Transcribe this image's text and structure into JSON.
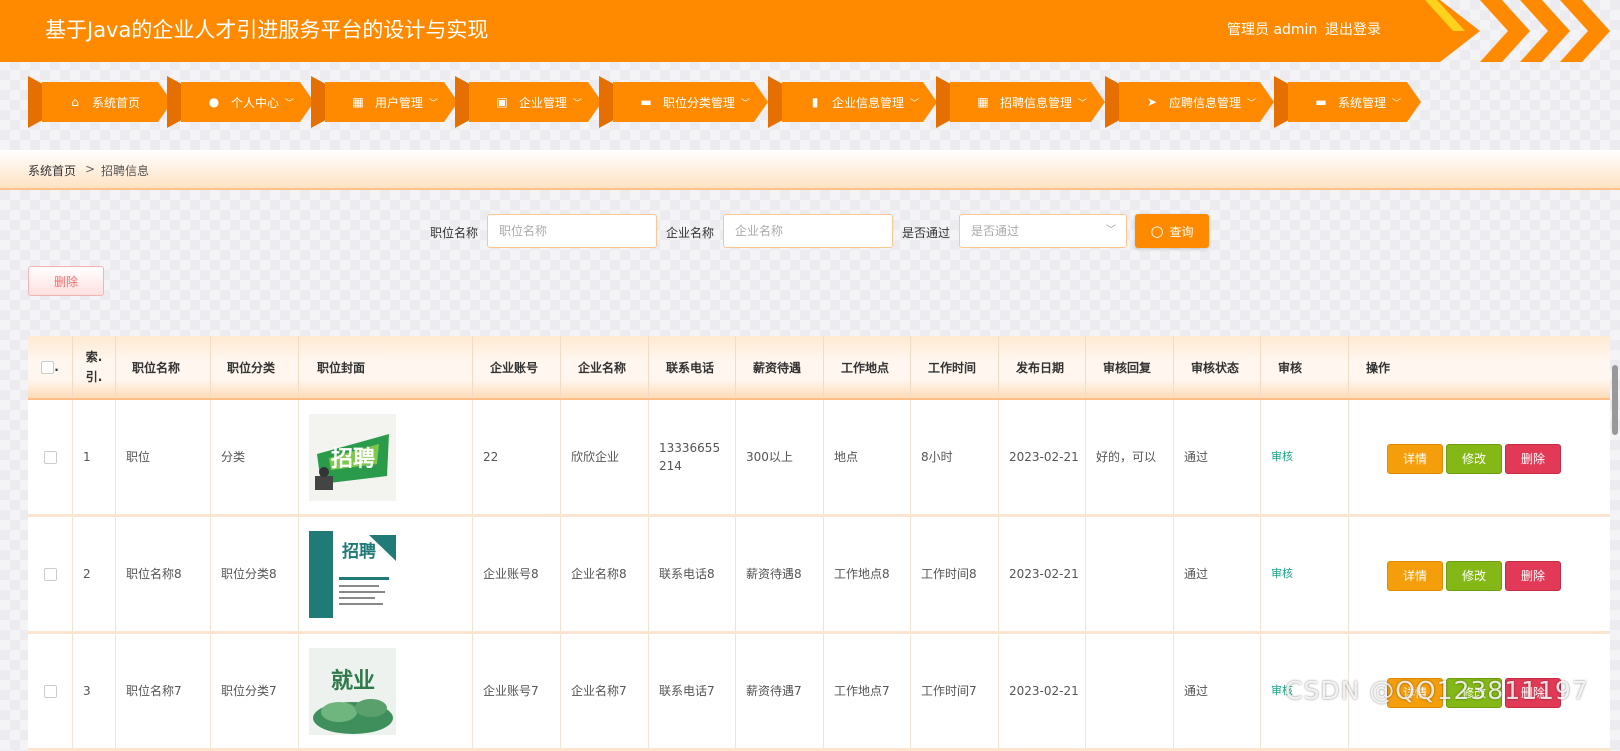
{
  "header": {
    "title": "基于Java的企业人才引进服务平台的设计与实现",
    "admin": "管理员 admin",
    "logout": "退出登录"
  },
  "nav": [
    {
      "label": "系统首页",
      "icon": "home-icon",
      "glyph": "⌂"
    },
    {
      "label": "个人中心",
      "icon": "user-icon",
      "glyph": "●"
    },
    {
      "label": "用户管理",
      "icon": "grid-icon",
      "glyph": "▦"
    },
    {
      "label": "企业管理",
      "icon": "clipboard-icon",
      "glyph": "▣"
    },
    {
      "label": "职位分类管理",
      "icon": "monitor-icon",
      "glyph": "▬"
    },
    {
      "label": "企业信息管理",
      "icon": "bar-chart-icon",
      "glyph": "▮"
    },
    {
      "label": "招聘信息管理",
      "icon": "grid-icon",
      "glyph": "▦"
    },
    {
      "label": "应聘信息管理",
      "icon": "send-icon",
      "glyph": "➤"
    },
    {
      "label": "系统管理",
      "icon": "monitor-icon",
      "glyph": "▬"
    }
  ],
  "breadcrumb": {
    "home": "系统首页",
    "sep": ">",
    "current": "招聘信息"
  },
  "search": {
    "position_label": "职位名称",
    "position_placeholder": "职位名称",
    "company_label": "企业名称",
    "company_placeholder": "企业名称",
    "passed_label": "是否通过",
    "passed_placeholder": "是否通过",
    "query_button": "查询"
  },
  "toolbar": {
    "delete_button": "删除"
  },
  "table": {
    "columns": [
      "索引",
      "职位名称",
      "职位分类",
      "职位封面",
      "企业账号",
      "企业名称",
      "联系电话",
      "薪资待遇",
      "工作地点",
      "工作时间",
      "发布日期",
      "审核回复",
      "审核状态",
      "审核",
      "操作"
    ],
    "index_header": "索.\n引.",
    "rows": [
      {
        "index": "1",
        "name": "职位",
        "category": "分类",
        "account": "22",
        "company": "欣欣企业",
        "phone": "13336655214",
        "salary": "300以上",
        "location": "地点",
        "hours": "8小时",
        "date": "2023-02-21",
        "reply": "好的，可以",
        "status": "通过",
        "audit": "审核"
      },
      {
        "index": "2",
        "name": "职位名称8",
        "category": "职位分类8",
        "account": "企业账号8",
        "company": "企业名称8",
        "phone": "联系电话8",
        "salary": "薪资待遇8",
        "location": "工作地点8",
        "hours": "工作时间8",
        "date": "2023-02-21",
        "reply": "",
        "status": "通过",
        "audit": "审核"
      },
      {
        "index": "3",
        "name": "职位名称7",
        "category": "职位分类7",
        "account": "企业账号7",
        "company": "企业名称7",
        "phone": "联系电话7",
        "salary": "薪资待遇7",
        "location": "工作地点7",
        "hours": "工作时间7",
        "date": "2023-02-21",
        "reply": "",
        "status": "通过",
        "audit": "审核"
      }
    ],
    "actions": {
      "detail": "详情",
      "edit": "修改",
      "delete": "删除"
    }
  },
  "cover_texts": [
    "招聘",
    "招聘",
    "就业"
  ],
  "watermark": "CSDN @QQ123811197",
  "colors": {
    "accent": "#ff8a00",
    "detail": "#f59e0b",
    "edit": "#84b817",
    "delete": "#e23a56",
    "audit": "#19a88b"
  }
}
